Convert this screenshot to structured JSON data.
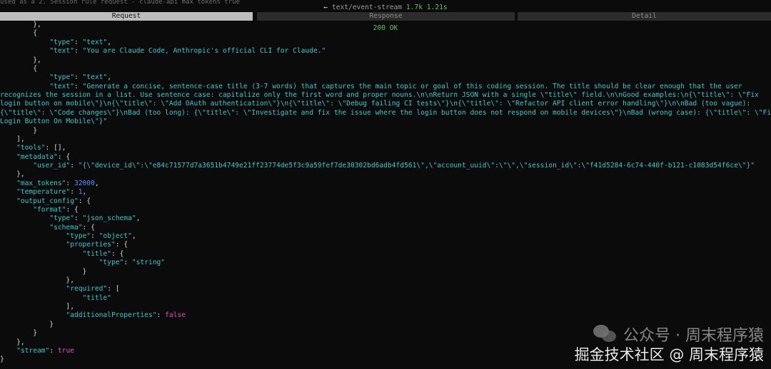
{
  "header": {
    "top_line": "used as a 2. Session rule  request  - claude-api  max_tokens  true",
    "status_prefix": "←",
    "status_code": "200 OK",
    "content_type": "text/event-stream",
    "size": "1.7k",
    "time": "1.21s"
  },
  "tabs": [
    {
      "label": "Request",
      "active": true
    },
    {
      "label": "Response",
      "active": false
    },
    {
      "label": "Detail",
      "active": false
    }
  ],
  "body": {
    "system_text_1": "You are Claude Code, Anthropic's official CLI for Claude.",
    "title_prompt_lines": [
      "Generate a concise, sentence-case title (3-7 words) that captures the main topic or goal of this coding session. The title should be clear enough that the user",
      "recognizes the session in a list. Use sentence case: capitalize only the first word and proper nouns.\\n\\nReturn JSON with a single \\\"title\\\" field.\\n\\nGood examples:\\n{\\\"title\\\": \\\"Fix",
      "login button on mobile\\\"}\\n{\\\"title\\\": \\\"Add OAuth authentication\\\"}\\n{\\\"title\\\": \\\"Debug failing CI tests\\\"}\\n{\\\"title\\\": \\\"Refactor API client error handling\\\"}\\n\\nBad (too vague):",
      "{\\\"title\\\": \\\"Code changes\\\"}\\nBad (too long): {\\\"title\\\": \\\"Investigate and fix the issue where the login button does not respond on mobile devices\\\"}\\nBad (wrong case): {\\\"title\\\": \\\"Fix",
      "Login Button On Mobile\\\"}"
    ],
    "keys": {
      "type": "\"type\"",
      "text": "\"text\"",
      "tools": "\"tools\"",
      "metadata": "\"metadata\"",
      "user_id": "\"user_id\"",
      "max_tokens": "\"max_tokens\"",
      "temperature": "\"temperature\"",
      "output_config": "\"output_config\"",
      "format": "\"format\"",
      "schema": "\"schema\"",
      "properties": "\"properties\"",
      "title": "\"title\"",
      "required": "\"required\"",
      "additionalProperties": "\"additionalProperties\"",
      "stream": "\"stream\""
    },
    "values": {
      "text_type": "\"text\"",
      "user_id": "\"{\\\"device_id\\\":\\\"e84c71577d7a3651b4749e21ff23774de5f3c9a59fef7de30302bd6adb4fd561\\\",\\\"account_uuid\\\":\\\"\\\",\\\"session_id\\\":\\\"f41d5284-6c74-440f-b121-c1083d54f6ce\\\"}\"",
      "max_tokens": "32000",
      "temperature": "1",
      "format_type": "\"json_schema\"",
      "schema_type": "\"object\"",
      "title_type": "\"string\"",
      "required_item": "\"title\"",
      "additionalProperties": "false",
      "stream": "true"
    }
  },
  "watermark": {
    "line1": "公众号 · 周末程序猿",
    "line2": "掘金技术社区 @ 周末程序猿"
  }
}
